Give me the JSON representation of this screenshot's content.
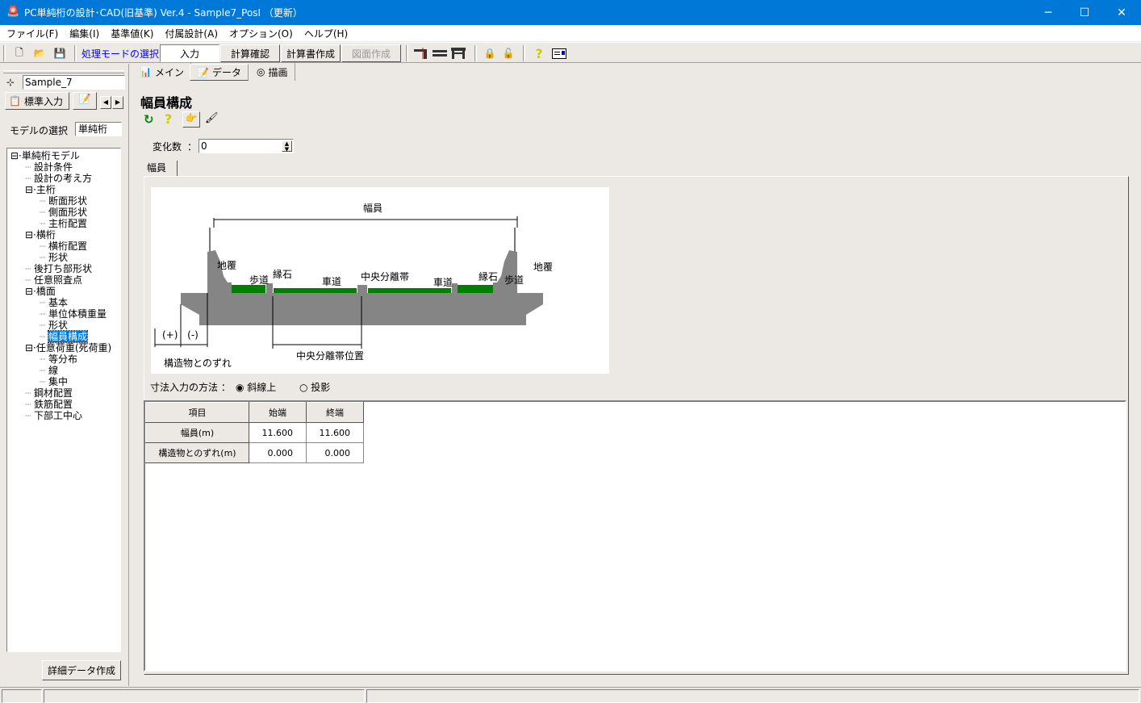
{
  "window": {
    "title": "PC単純桁の設計･CAD(旧基準) Ver.4 - Sample7_PosI （更新）",
    "minimize": "─",
    "maximize": "☐",
    "close": "✕"
  },
  "menu": [
    "ファイル(F)",
    "編集(I)",
    "基準値(K)",
    "付属設計(A)",
    "オプション(O)",
    "ヘルプ(H)"
  ],
  "toolbar": {
    "mode_label": "処理モードの選択",
    "input": "入力",
    "calc_check": "計算確認",
    "report": "計算書作成",
    "drawing": "図面作成"
  },
  "main_tabs": [
    "メイン",
    "データ",
    "描画"
  ],
  "left": {
    "project": "Sample_7",
    "tab_standard": "標準入力",
    "model_label": "モデルの選択",
    "model_value": "単純桁",
    "detail_button": "詳細データ作成",
    "tree": [
      {
        "label": "単純桁モデル",
        "level": 0,
        "exp": true
      },
      {
        "label": "設計条件",
        "level": 1
      },
      {
        "label": "設計の考え方",
        "level": 1
      },
      {
        "label": "主桁",
        "level": 1,
        "exp": true
      },
      {
        "label": "断面形状",
        "level": 2
      },
      {
        "label": "側面形状",
        "level": 2
      },
      {
        "label": "主桁配置",
        "level": 2
      },
      {
        "label": "横桁",
        "level": 1,
        "exp": true
      },
      {
        "label": "横桁配置",
        "level": 2
      },
      {
        "label": "形状",
        "level": 2
      },
      {
        "label": "後打ち部形状",
        "level": 1
      },
      {
        "label": "任意照査点",
        "level": 1
      },
      {
        "label": "橋面",
        "level": 1,
        "exp": true
      },
      {
        "label": "基本",
        "level": 2
      },
      {
        "label": "単位体積重量",
        "level": 2
      },
      {
        "label": "形状",
        "level": 2
      },
      {
        "label": "幅員構成",
        "level": 2,
        "selected": true
      },
      {
        "label": "任意荷重(死荷重)",
        "level": 1,
        "exp": true
      },
      {
        "label": "等分布",
        "level": 2
      },
      {
        "label": "線",
        "level": 2
      },
      {
        "label": "集中",
        "level": 2
      },
      {
        "label": "鋼材配置",
        "level": 1
      },
      {
        "label": "鉄筋配置",
        "level": 1
      },
      {
        "label": "下部工中心",
        "level": 1
      }
    ]
  },
  "page": {
    "title": "幅員構成",
    "change_label": "変化数",
    "change_sep": "：",
    "change_value": "0",
    "subtab": "幅員",
    "method_label": "寸法入力の方法 ：",
    "radio_options": [
      "斜線上",
      "投影"
    ],
    "radio_selected": 0
  },
  "diagram": {
    "width": "幅員",
    "left_curb": "地覆",
    "right_curb": "地覆",
    "sidewalk": "歩道",
    "curbstone": "縁石",
    "roadway": "車道",
    "median": "中央分離帯",
    "plus": "(+)",
    "minus": "(-)",
    "offset": "構造物とのずれ",
    "median_pos": "中央分離帯位置"
  },
  "table": {
    "headers": [
      "項目",
      "始端",
      "終端"
    ],
    "rows": [
      [
        "幅員(m)",
        "11.600",
        "11.600"
      ],
      [
        "構造物とのずれ(m)",
        "0.000",
        "0.000"
      ]
    ]
  },
  "colors": {
    "titlebar": "#0078d7",
    "green": "#008000",
    "gray": "#808080",
    "selected": "#0078d7"
  }
}
